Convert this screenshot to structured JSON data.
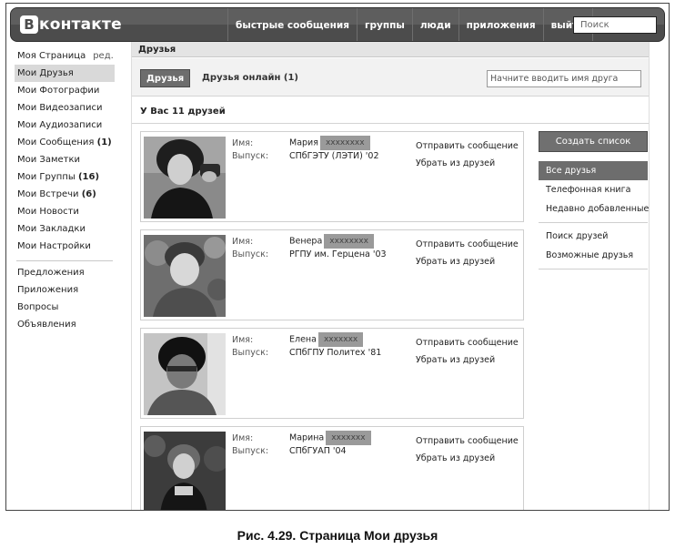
{
  "header": {
    "logo_letter": "B",
    "logo_text": "контакте",
    "nav": [
      "быстрые сообщения",
      "группы",
      "люди",
      "приложения",
      "выйти"
    ],
    "search_placeholder": "Поиск"
  },
  "left_menu": {
    "my_page": "Моя Страница",
    "edit": "ред.",
    "items": [
      {
        "label": "Мои Друзья",
        "count": "",
        "active": true
      },
      {
        "label": "Мои Фотографии",
        "count": ""
      },
      {
        "label": "Мои Видеозаписи",
        "count": ""
      },
      {
        "label": "Мои Аудиозаписи",
        "count": ""
      },
      {
        "label": "Мои Сообщения",
        "count": "(1)"
      },
      {
        "label": "Мои Заметки",
        "count": ""
      },
      {
        "label": "Мои Группы",
        "count": "(16)"
      },
      {
        "label": "Мои Встречи",
        "count": "(6)"
      },
      {
        "label": "Мои Новости",
        "count": ""
      },
      {
        "label": "Мои Закладки",
        "count": ""
      },
      {
        "label": "Мои Настройки",
        "count": ""
      }
    ],
    "secondary": [
      "Предложения",
      "Приложения",
      "Вопросы",
      "Объявления"
    ]
  },
  "main": {
    "section_title": "Друзья",
    "tab_friends": "Друзья",
    "tab_online": "Друзья онлайн (1)",
    "friend_search_placeholder": "Начните вводить имя друга",
    "count_text": "У Вас 11 друзей"
  },
  "friend_labels": {
    "name": "Имя:",
    "graduation": "Выпуск:"
  },
  "friends": [
    {
      "first_name": "Мария",
      "surname_redacted": "xxxxxxxx",
      "graduation": "СПбГЭТУ (ЛЭТИ) '02",
      "send_message": "Отправить сообщение",
      "remove": "Убрать из друзей"
    },
    {
      "first_name": "Венера",
      "surname_redacted": "xxxxxxxx",
      "graduation": "РГПУ им. Герцена '03",
      "send_message": "Отправить сообщение",
      "remove": "Убрать из друзей"
    },
    {
      "first_name": "Елена",
      "surname_redacted": "xxxxxxx",
      "graduation": "СПбГПУ Политех '81",
      "send_message": "Отправить сообщение",
      "remove": "Убрать из друзей"
    },
    {
      "first_name": "Марина",
      "surname_redacted": "xxxxxxx",
      "graduation": "СПбГУАП '04",
      "send_message": "Отправить сообщение",
      "remove": "Убрать из друзей"
    }
  ],
  "sidebar": {
    "create_list": "Создать список",
    "lists": [
      "Все друзья",
      "Телефонная книга",
      "Недавно добавленные"
    ],
    "links": [
      "Поиск друзей",
      "Возможные друзья"
    ]
  },
  "caption": {
    "prefix": "Рис. 4.29. Страница ",
    "bold": "Мои друзья"
  }
}
